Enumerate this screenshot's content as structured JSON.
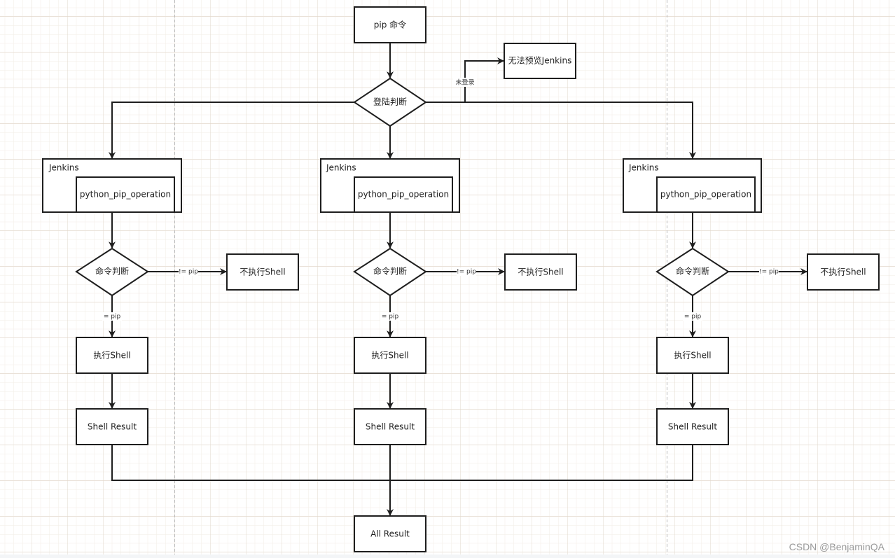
{
  "diagram": {
    "start": {
      "label": "pip 命令"
    },
    "login_check": {
      "label": "登陆判断"
    },
    "not_logged_in_edge": {
      "label": "未登录"
    },
    "no_preview": {
      "label": "无法预览Jenkins"
    },
    "columns": [
      {
        "container": {
          "label": "Jenkins"
        },
        "job": {
          "label": "python_pip_operation"
        },
        "command_check": {
          "label": "命令判断"
        },
        "not_equal_edge": {
          "label": "!= pip"
        },
        "skip": {
          "label": "不执行Shell"
        },
        "equal_edge": {
          "label": "= pip"
        },
        "execute": {
          "label": "执行Shell"
        },
        "result": {
          "label": "Shell Result"
        }
      },
      {
        "container": {
          "label": "Jenkins"
        },
        "job": {
          "label": "python_pip_operation"
        },
        "command_check": {
          "label": "命令判断"
        },
        "not_equal_edge": {
          "label": "!= pip"
        },
        "skip": {
          "label": "不执行Shell"
        },
        "equal_edge": {
          "label": "= pip"
        },
        "execute": {
          "label": "执行Shell"
        },
        "result": {
          "label": "Shell Result"
        }
      },
      {
        "container": {
          "label": "Jenkins"
        },
        "job": {
          "label": "python_pip_operation"
        },
        "command_check": {
          "label": "命令判断"
        },
        "not_equal_edge": {
          "label": "!= pip"
        },
        "skip": {
          "label": "不执行Shell"
        },
        "equal_edge": {
          "label": "= pip"
        },
        "execute": {
          "label": "执行Shell"
        },
        "result": {
          "label": "Shell Result"
        }
      }
    ],
    "final": {
      "label": "All Result"
    }
  },
  "watermark": "CSDN @BenjaminQA",
  "colors": {
    "stroke": "#1e1e1e",
    "grid_minor": "#f2ede6",
    "grid_major": "#e2d8cc",
    "page_break": "#b8b8b8"
  }
}
